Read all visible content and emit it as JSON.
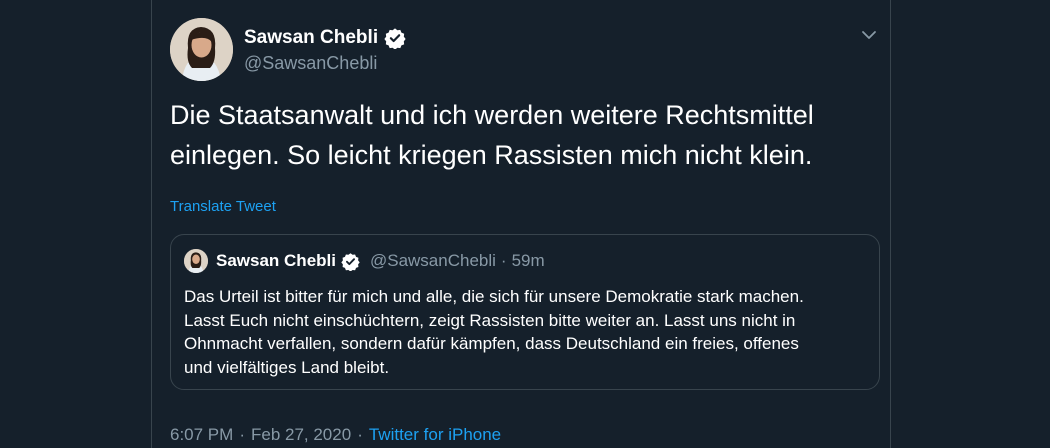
{
  "author": {
    "name": "Sawsan Chebli",
    "handle": "@SawsanChebli"
  },
  "tweet": {
    "text_line1": "Die Staatsanwalt und ich werden weitere Rechtsmittel",
    "text_line2": "einlegen. So leicht kriegen Rassisten mich nicht klein.",
    "translate_label": "Translate Tweet"
  },
  "quoted": {
    "name": "Sawsan Chebli",
    "handle": "@SawsanChebli",
    "dot": "·",
    "time": "59m",
    "line1": "Das Urteil ist bitter für mich und alle, die sich für unsere Demokratie stark machen.",
    "line2": "Lasst Euch nicht einschüchtern, zeigt Rassisten bitte weiter an. Lasst uns nicht in",
    "line3": "Ohnmacht verfallen, sondern dafür kämpfen, dass Deutschland ein freies, offenes",
    "line4": "und vielfältiges Land bleibt."
  },
  "meta": {
    "time": "6:07 PM",
    "sep1": "·",
    "date": "Feb 27, 2020",
    "sep2": "·",
    "source": "Twitter for iPhone"
  },
  "colors": {
    "background": "#15202b",
    "accent": "#1da1f2",
    "muted": "#8899a6",
    "border": "#38444d"
  },
  "icons": [
    "verified-badge-icon",
    "chevron-down-icon"
  ]
}
